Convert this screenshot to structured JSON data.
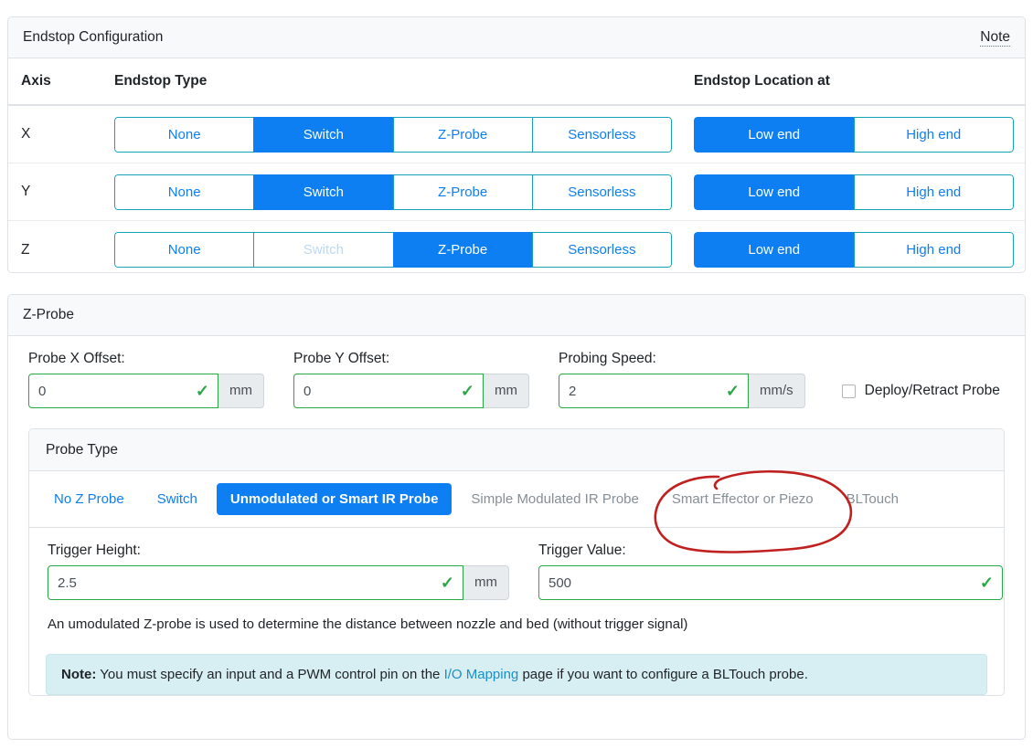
{
  "endstop": {
    "title": "Endstop Configuration",
    "note_label": "Note",
    "columns": {
      "axis": "Axis",
      "type": "Endstop Type",
      "location": "Endstop Location at"
    },
    "type_options": [
      "None",
      "Switch",
      "Z-Probe",
      "Sensorless"
    ],
    "location_options": [
      "Low end",
      "High end"
    ],
    "rows": [
      {
        "axis": "X",
        "selected_type": "Switch",
        "disabled_types": [],
        "selected_location": "Low end"
      },
      {
        "axis": "Y",
        "selected_type": "Switch",
        "disabled_types": [],
        "selected_location": "Low end"
      },
      {
        "axis": "Z",
        "selected_type": "Z-Probe",
        "disabled_types": [
          "Switch"
        ],
        "selected_location": "Low end"
      }
    ]
  },
  "zprobe": {
    "title": "Z-Probe",
    "fields": [
      {
        "label": "Probe X Offset:",
        "value": "0",
        "unit": "mm",
        "valid": true
      },
      {
        "label": "Probe Y Offset:",
        "value": "0",
        "unit": "mm",
        "valid": true
      },
      {
        "label": "Probing Speed:",
        "value": "2",
        "unit": "mm/s",
        "valid": true
      }
    ],
    "deploy_retract": {
      "label": "Deploy/Retract Probe",
      "checked": false
    },
    "probe_type": {
      "title": "Probe Type",
      "tabs": [
        {
          "label": "No Z Probe",
          "state": "enabled"
        },
        {
          "label": "Switch",
          "state": "enabled"
        },
        {
          "label": "Unmodulated or Smart IR Probe",
          "state": "active"
        },
        {
          "label": "Simple Modulated IR Probe",
          "state": "muted"
        },
        {
          "label": "Smart Effector or Piezo",
          "state": "muted"
        },
        {
          "label": "BLTouch",
          "state": "muted"
        }
      ],
      "trigger_height": {
        "label": "Trigger Height:",
        "value": "2.5",
        "unit": "mm",
        "valid": true
      },
      "trigger_value": {
        "label": "Trigger Value:",
        "value": "500",
        "valid": true
      },
      "description": "An umodulated Z-probe is used to determine the distance between nozzle and bed (without trigger signal)",
      "note": {
        "prefix": "Note:",
        "text_before": " You must specify an input and a PWM control pin on the ",
        "link": "I/O Mapping",
        "text_after": " page if you want to configure a BLTouch probe."
      }
    }
  },
  "annotation": {
    "kind": "hand-drawn-ellipse",
    "target": "Smart Effector or Piezo",
    "color": "#c0201f"
  },
  "theme": {
    "accent_blue": "#0d7ff2",
    "valid_green": "#28a745",
    "card_border": "#dee2e6",
    "header_bg": "#f8f9fa",
    "note_bg": "#d7eef2",
    "link_blue": "#1a8fc9"
  }
}
